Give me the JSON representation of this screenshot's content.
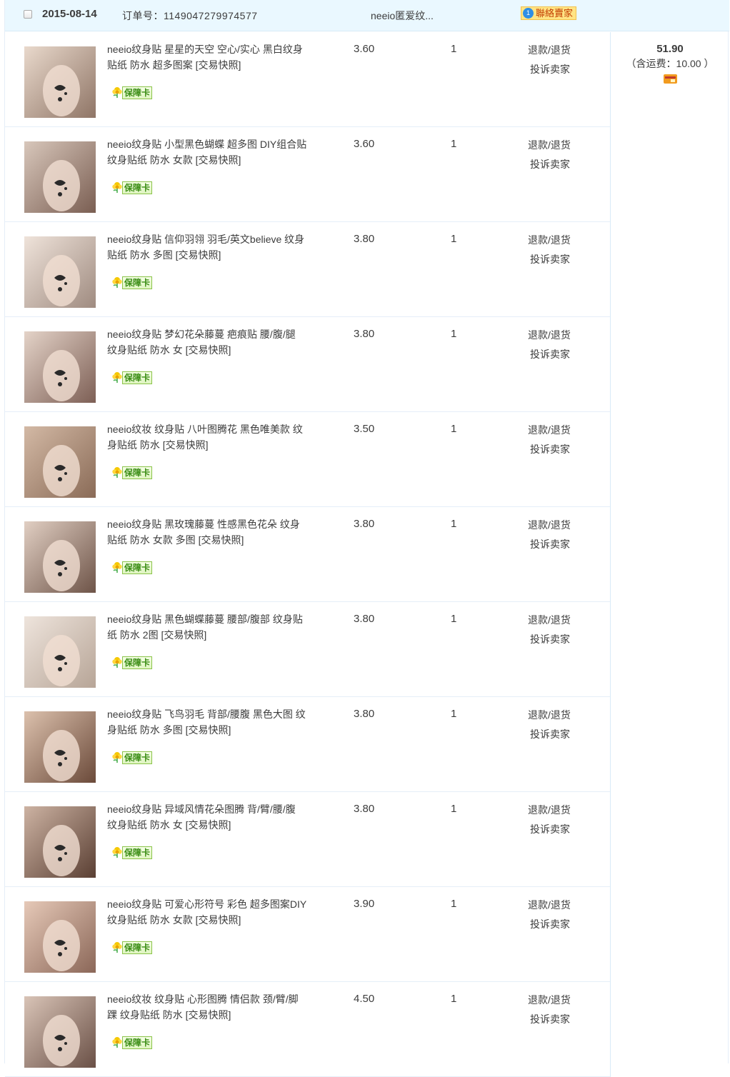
{
  "header": {
    "date": "2015-08-14",
    "order_label": "订单号：1149047279974577",
    "shop_name": "neeio匿爱纹...",
    "contact_label": "聯絡賣家",
    "contact_badge": "1"
  },
  "items": [
    {
      "title": "neeio纹身贴 星星的天空 空心/实心 黑白纹身贴纸 防水 超多图案 ",
      "snapshot": "[交易快照]",
      "badge": "保障卡",
      "price": "3.60",
      "qty": "1",
      "refund": "退款/退货",
      "complain": "投诉卖家"
    },
    {
      "title": "neeio纹身贴 小型黑色蝴蝶 超多图 DIY组合贴 纹身贴纸 防水 女款 ",
      "snapshot": "[交易快照]",
      "badge": "保障卡",
      "price": "3.60",
      "qty": "1",
      "refund": "退款/退货",
      "complain": "投诉卖家"
    },
    {
      "title": "neeio纹身贴 信仰羽翎 羽毛/英文believe 纹身贴纸 防水 多图 ",
      "snapshot": "[交易快照]",
      "badge": "保障卡",
      "price": "3.80",
      "qty": "1",
      "refund": "退款/退货",
      "complain": "投诉卖家"
    },
    {
      "title": "neeio纹身贴 梦幻花朵藤蔓 疤痕贴 腰/腹/腿 纹身贴纸 防水 女 ",
      "snapshot": "[交易快照]",
      "badge": "保障卡",
      "price": "3.80",
      "qty": "1",
      "refund": "退款/退货",
      "complain": "投诉卖家"
    },
    {
      "title": "neeio纹妆 纹身贴 八叶图腾花 黑色唯美款 纹身贴纸 防水 ",
      "snapshot": "[交易快照]",
      "badge": "保障卡",
      "price": "3.50",
      "qty": "1",
      "refund": "退款/退货",
      "complain": "投诉卖家"
    },
    {
      "title": "neeio纹身贴 黑玫瑰藤蔓 性感黑色花朵 纹身贴纸 防水 女款 多图 ",
      "snapshot": "[交易快照]",
      "badge": "保障卡",
      "price": "3.80",
      "qty": "1",
      "refund": "退款/退货",
      "complain": "投诉卖家"
    },
    {
      "title": "neeio纹身贴 黑色蝴蝶藤蔓 腰部/腹部 纹身贴纸 防水 2图 ",
      "snapshot": "[交易快照]",
      "badge": "保障卡",
      "price": "3.80",
      "qty": "1",
      "refund": "退款/退货",
      "complain": "投诉卖家"
    },
    {
      "title": "neeio纹身贴 飞鸟羽毛 背部/腰腹 黑色大图 纹身贴纸 防水 多图 ",
      "snapshot": "[交易快照]",
      "badge": "保障卡",
      "price": "3.80",
      "qty": "1",
      "refund": "退款/退货",
      "complain": "投诉卖家"
    },
    {
      "title": "neeio纹身贴 异域风情花朵图腾 背/臂/腰/腹 纹身贴纸 防水 女 ",
      "snapshot": "[交易快照]",
      "badge": "保障卡",
      "price": "3.80",
      "qty": "1",
      "refund": "退款/退货",
      "complain": "投诉卖家"
    },
    {
      "title": "neeio纹身贴 可爱心形符号 彩色 超多图案DIY 纹身贴纸 防水 女款 ",
      "snapshot": "[交易快照]",
      "badge": "保障卡",
      "price": "3.90",
      "qty": "1",
      "refund": "退款/退货",
      "complain": "投诉卖家"
    },
    {
      "title": "neeio纹妆 纹身贴 心形图腾 情侣款 颈/臂/脚踝 纹身贴纸 防水 ",
      "snapshot": "[交易快照]",
      "badge": "保障卡",
      "price": "4.50",
      "qty": "1",
      "refund": "退款/退货",
      "complain": "投诉卖家"
    }
  ],
  "summary": {
    "total": "51.90",
    "shipping": "（含运费：10.00 ）"
  },
  "colors": {
    "header_bg": "#eaf8ff",
    "border": "#e5eef8",
    "badge_green": "#3b8d15",
    "contact_bg": "#ffe484"
  }
}
